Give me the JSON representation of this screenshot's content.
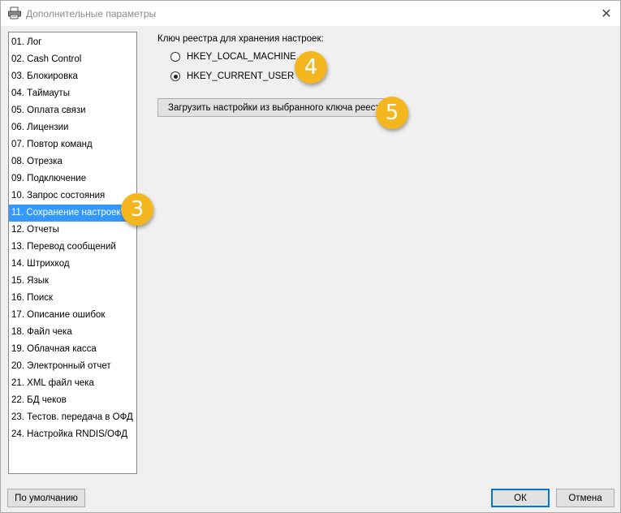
{
  "window": {
    "title": "Дополнительные параметры",
    "close_glyph": "✕",
    "icon": "printer-icon"
  },
  "sidebar": {
    "items": [
      {
        "label": "01. Лог"
      },
      {
        "label": "02. Cash Control"
      },
      {
        "label": "03. Блокировка"
      },
      {
        "label": "04. Таймауты"
      },
      {
        "label": "05. Оплата связи"
      },
      {
        "label": "06. Лицензии"
      },
      {
        "label": "07. Повтор команд"
      },
      {
        "label": "08. Отрезка"
      },
      {
        "label": "09. Подключение"
      },
      {
        "label": "10. Запрос состояния"
      },
      {
        "label": "11. Сохранение настроек",
        "selected": true
      },
      {
        "label": "12. Отчеты"
      },
      {
        "label": "13. Перевод сообщений"
      },
      {
        "label": "14. Штрихкод"
      },
      {
        "label": "15. Язык"
      },
      {
        "label": "16. Поиск"
      },
      {
        "label": "17. Описание ошибок"
      },
      {
        "label": "18. Файл чека"
      },
      {
        "label": "19. Облачная касса"
      },
      {
        "label": "20. Электронный отчет"
      },
      {
        "label": "21. XML файл чека"
      },
      {
        "label": "22. БД чеков"
      },
      {
        "label": "23. Тестов. передача в ОФД"
      },
      {
        "label": "24. Настройка RNDIS/ОФД"
      }
    ]
  },
  "main": {
    "group_label": "Ключ реестра для хранения настроек:",
    "radios": [
      {
        "label": "HKEY_LOCAL_MACHINE",
        "checked": false
      },
      {
        "label": "HKEY_CURRENT_USER",
        "checked": true
      }
    ],
    "load_button": "Загрузить настройки из выбранного ключа реестра"
  },
  "badges": {
    "b3": "3",
    "b4": "4",
    "b5": "5"
  },
  "footer": {
    "defaults_button": "По умолчанию",
    "ok_button": "ОК",
    "cancel_button": "Отмена"
  },
  "colors": {
    "selection": "#3399ff",
    "badge": "#f4b61e",
    "window_bg": "#f0f0f0"
  }
}
